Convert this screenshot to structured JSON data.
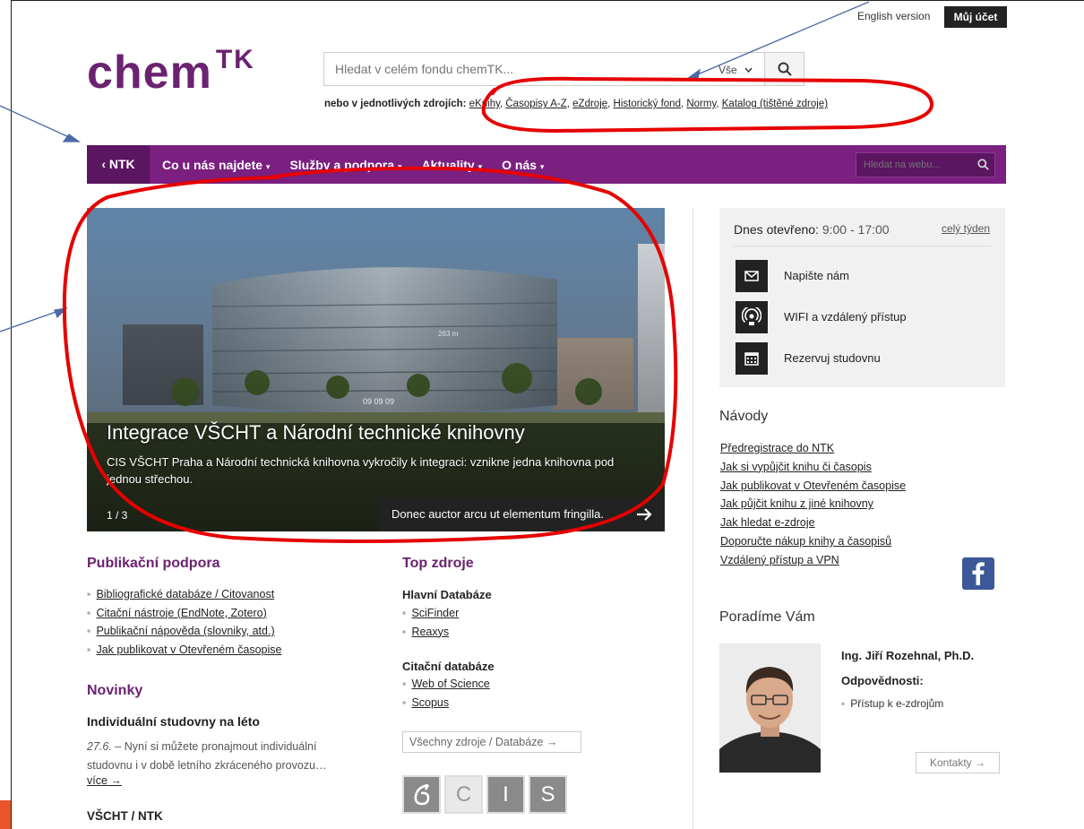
{
  "topbar": {
    "english": "English version",
    "account": "Můj účet"
  },
  "logo": {
    "main": "chem",
    "sup": "TK"
  },
  "search": {
    "placeholder": "Hledat v celém fondu chemTK...",
    "scope": "Vše"
  },
  "sources": {
    "prefix": "nebo v jednotlivých zdrojích:",
    "links": [
      "eKnihy",
      "Časopisy A-Z",
      "eZdroje",
      "Historický fond",
      "Normy",
      "Katalog (tištěné zdroje)"
    ]
  },
  "nav": {
    "back": "NTK",
    "items": [
      "Co u nás najdete",
      "Služby a podpora",
      "Aktuality",
      "O nás"
    ],
    "search_placeholder": "Hledat na webu..."
  },
  "hero": {
    "title": "Integrace VŠCHT a Národní technické knihovny",
    "text": "CIS VŠCHT Praha a Národní technická knihovna vykročily k integraci: vznikne jedna knihovna pod jednou střechou.",
    "counter": "1 / 3",
    "next": "Donec auctor arcu ut elementum fringilla.",
    "building_sign": "09 09 09",
    "building_number": "263 m"
  },
  "info": {
    "open_label": "Dnes otevřeno:",
    "open_hours": "9:00 - 17:00",
    "week": "celý týden",
    "rows": [
      "Napište nám",
      "WIFI a vzdálený přístup",
      "Rezervuj studovnu"
    ]
  },
  "navody": {
    "title": "Návody",
    "items": [
      "Předregistrace do NTK",
      "Jak si vypůjčit knihu či časopis",
      "Jak publikovat v Otevřeném časopise",
      "Jak půjčit knihu z jiné knihovny",
      "Jak hledat e-zdroje",
      "Doporučte nákup knihy a časopisů",
      "Vzdálený přístup a VPN"
    ]
  },
  "poradime": {
    "title": "Poradíme Vám",
    "name": "Ing. Jiří Rozehnal, Ph.D.",
    "resp_label": "Odpovědnosti:",
    "resp_item": "Přístup k e-zdrojům",
    "contacts": "Kontakty →"
  },
  "publikacni": {
    "title": "Publikační podpora",
    "items": [
      "Bibliografické databáze / Citovanost",
      "Citační nástroje (EndNote, Zotero)",
      "Publikační nápověda (slovniky, atd.)",
      "Jak publikovat v Otevřeném časopise"
    ]
  },
  "novinky": {
    "title": "Novinky",
    "item_title": "Individuální studovny na léto",
    "item_date": "27.6.",
    "item_text": "– Nyní si můžete pronajmout individuální studovnu i v době letního zkráceného provozu…",
    "more": "více →",
    "next_title": "VŠCHT / NTK"
  },
  "top": {
    "title": "Top zdroje",
    "group1": "Hlavní Databáze",
    "group1_items": [
      "SciFinder",
      "Reaxys"
    ],
    "group2": "Citační databáze",
    "group2_items": [
      "Web of Science",
      "Scopus"
    ],
    "all": "Všechny zdroje / Databáze →",
    "cis_letters": [
      "C",
      "I",
      "S"
    ]
  },
  "colors": {
    "brand": "#6b2270",
    "nav": "#7b1f80",
    "annotation": "#e60000",
    "arrow": "#4a6aa8"
  }
}
